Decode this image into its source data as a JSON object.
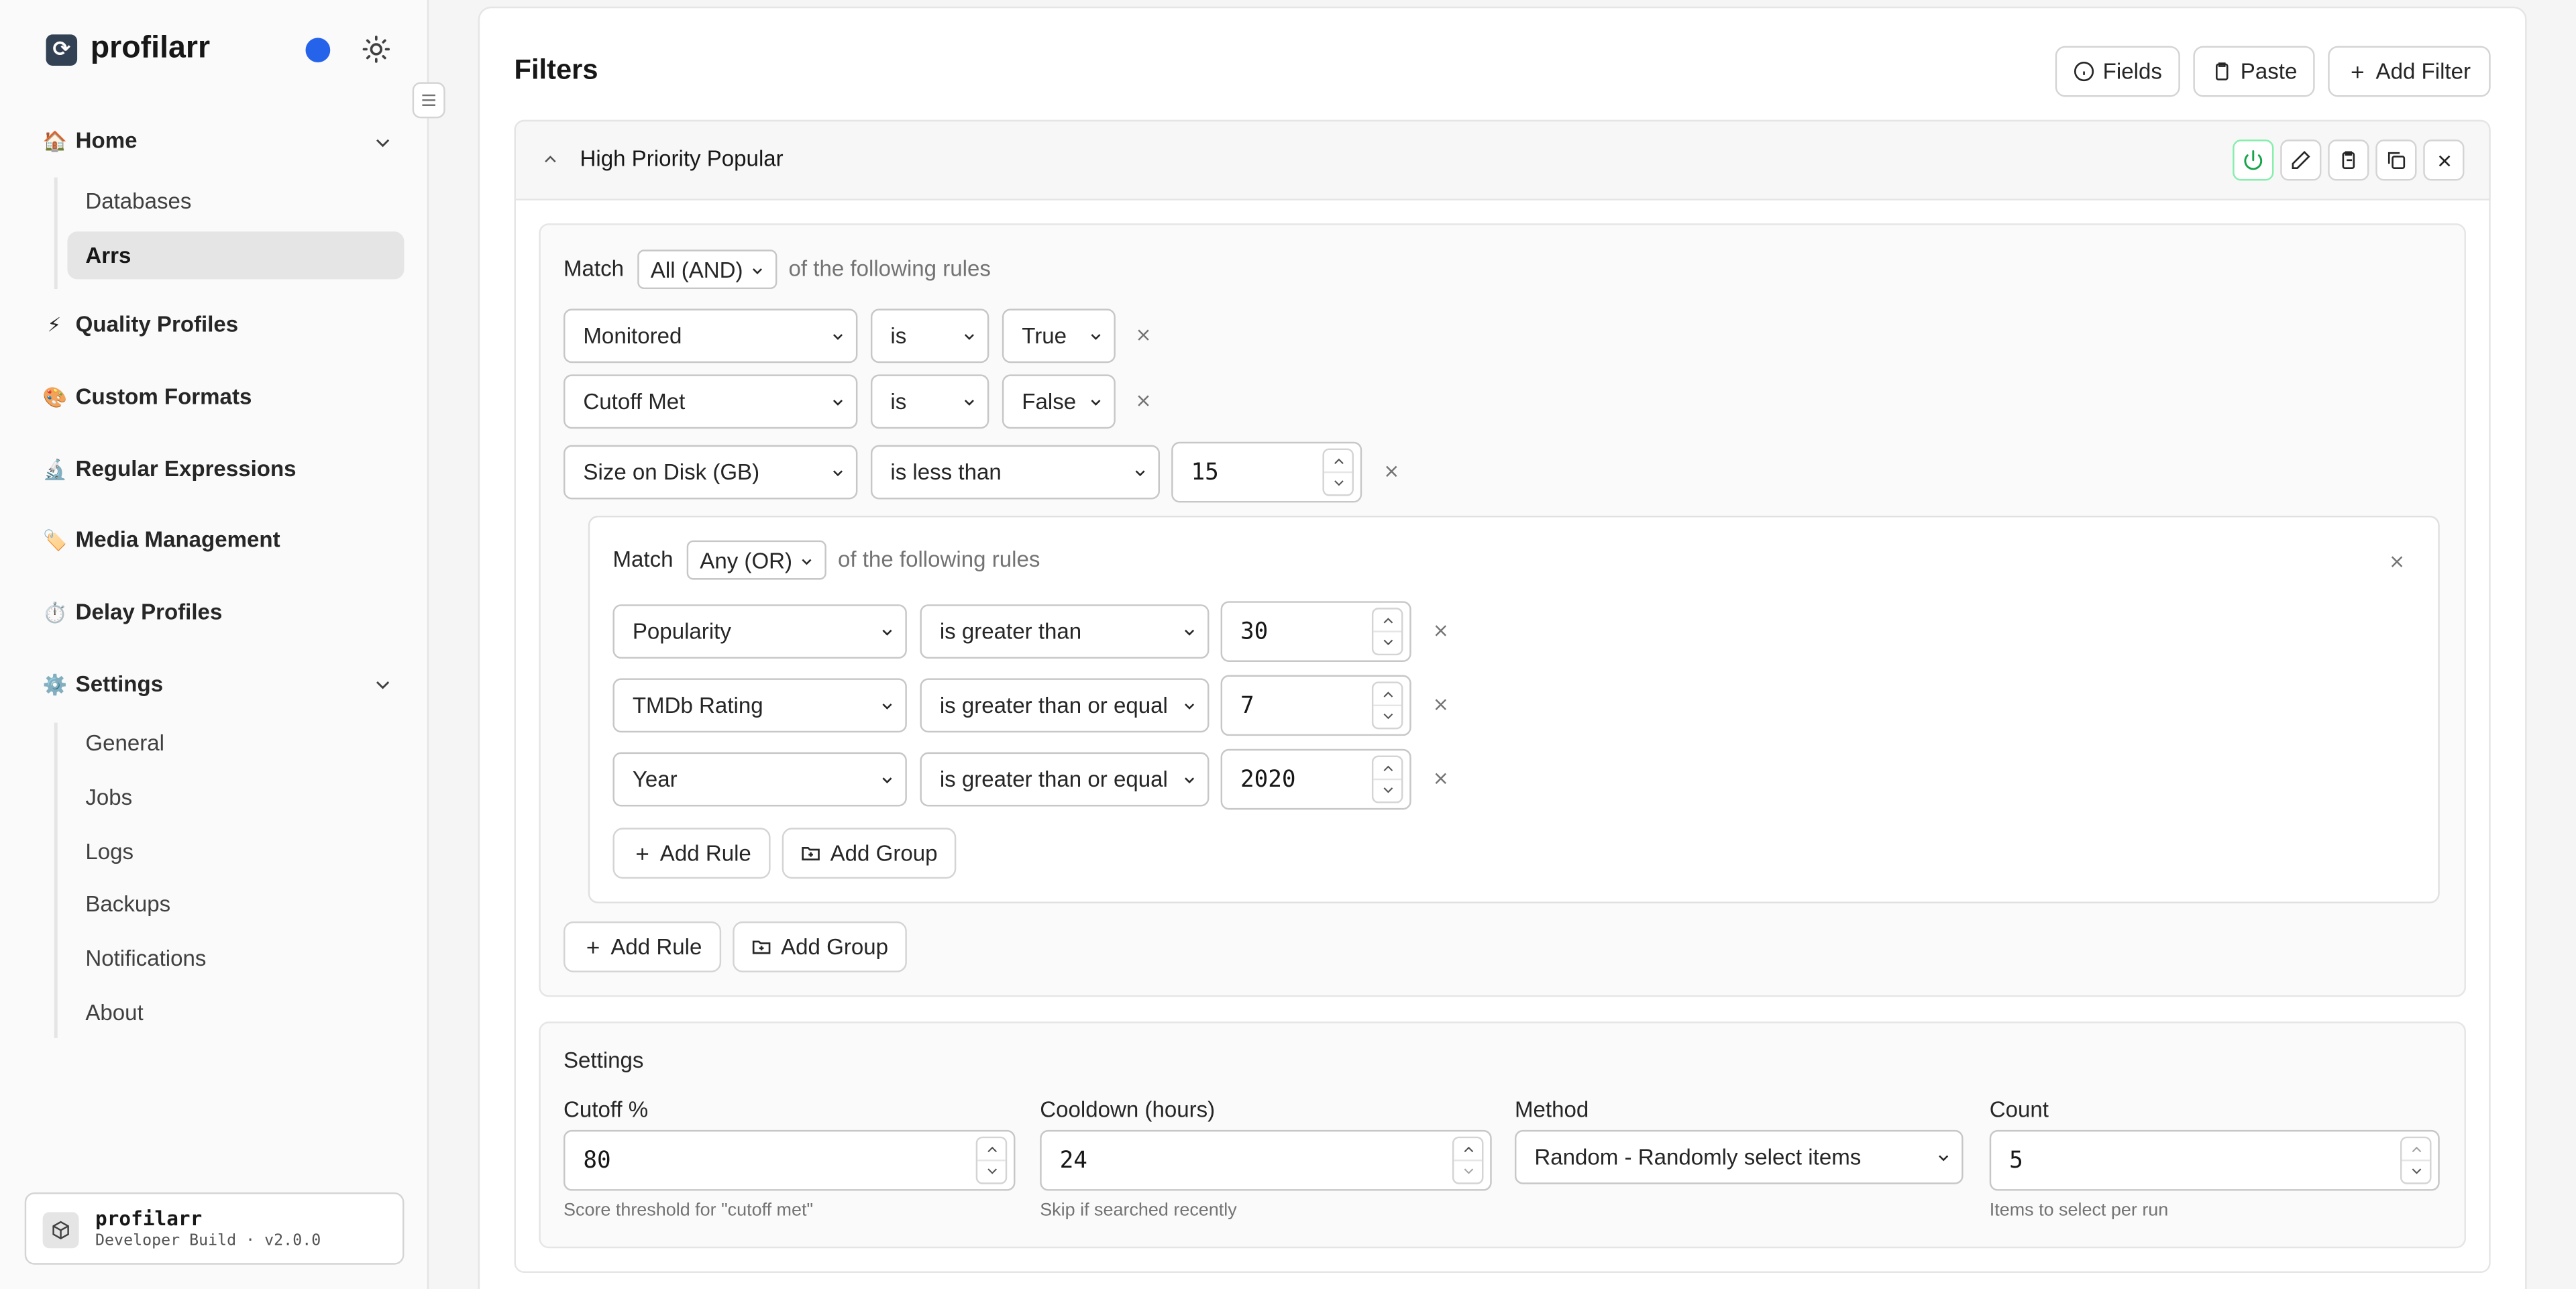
{
  "brand": {
    "name": "profilarr"
  },
  "sidebar": {
    "sections": [
      {
        "label": "Home",
        "emoji": "🏠"
      },
      {
        "label": "Quality Profiles",
        "emoji": "⚡"
      },
      {
        "label": "Custom Formats",
        "emoji": "🎨"
      },
      {
        "label": "Regular Expressions",
        "emoji": "🔬"
      },
      {
        "label": "Media Management",
        "emoji": "🏷️"
      },
      {
        "label": "Delay Profiles",
        "emoji": "⏱️"
      },
      {
        "label": "Settings",
        "emoji": "⚙️"
      }
    ],
    "home_items": [
      "Databases",
      "Arrs"
    ],
    "settings_items": [
      "General",
      "Jobs",
      "Logs",
      "Backups",
      "Notifications",
      "About"
    ],
    "active_item": "Arrs"
  },
  "footer": {
    "title": "profilarr",
    "subtitle": "Developer Build · v2.0.0"
  },
  "page": {
    "title": "Filters",
    "fields_label": "Fields",
    "paste_label": "Paste",
    "add_filter_label": "Add Filter"
  },
  "filter": {
    "name": "High Priority Popular",
    "root": {
      "match_label": "Match",
      "match_value": "All (AND)",
      "suffix": "of the following rules",
      "rules": [
        {
          "field": "Monitored",
          "op": "is",
          "value": "True"
        },
        {
          "field": "Cutoff Met",
          "op": "is",
          "value": "False"
        },
        {
          "field": "Size on Disk (GB)",
          "op": "is less than",
          "value": "15"
        }
      ],
      "add_rule": "Add Rule",
      "add_group": "Add Group"
    },
    "group": {
      "match_label": "Match",
      "match_value": "Any (OR)",
      "suffix": "of the following rules",
      "rules": [
        {
          "field": "Popularity",
          "op": "is greater than",
          "value": "30"
        },
        {
          "field": "TMDb Rating",
          "op": "is greater than or equal",
          "value": "7"
        },
        {
          "field": "Year",
          "op": "is greater than or equal",
          "value": "2020"
        }
      ],
      "add_rule": "Add Rule",
      "add_group": "Add Group"
    }
  },
  "settings": {
    "title": "Settings",
    "cutoff": {
      "label": "Cutoff %",
      "value": "80",
      "hint": "Score threshold for \"cutoff met\""
    },
    "cooldown": {
      "label": "Cooldown (hours)",
      "value": "24",
      "hint": "Skip if searched recently"
    },
    "method": {
      "label": "Method",
      "value": "Random - Randomly select items"
    },
    "count": {
      "label": "Count",
      "value": "5",
      "hint": "Items to select per run"
    }
  },
  "colors": {
    "accent": "#2563eb",
    "power_on": "#16a34a",
    "active_bg": "#e5e5e5"
  }
}
